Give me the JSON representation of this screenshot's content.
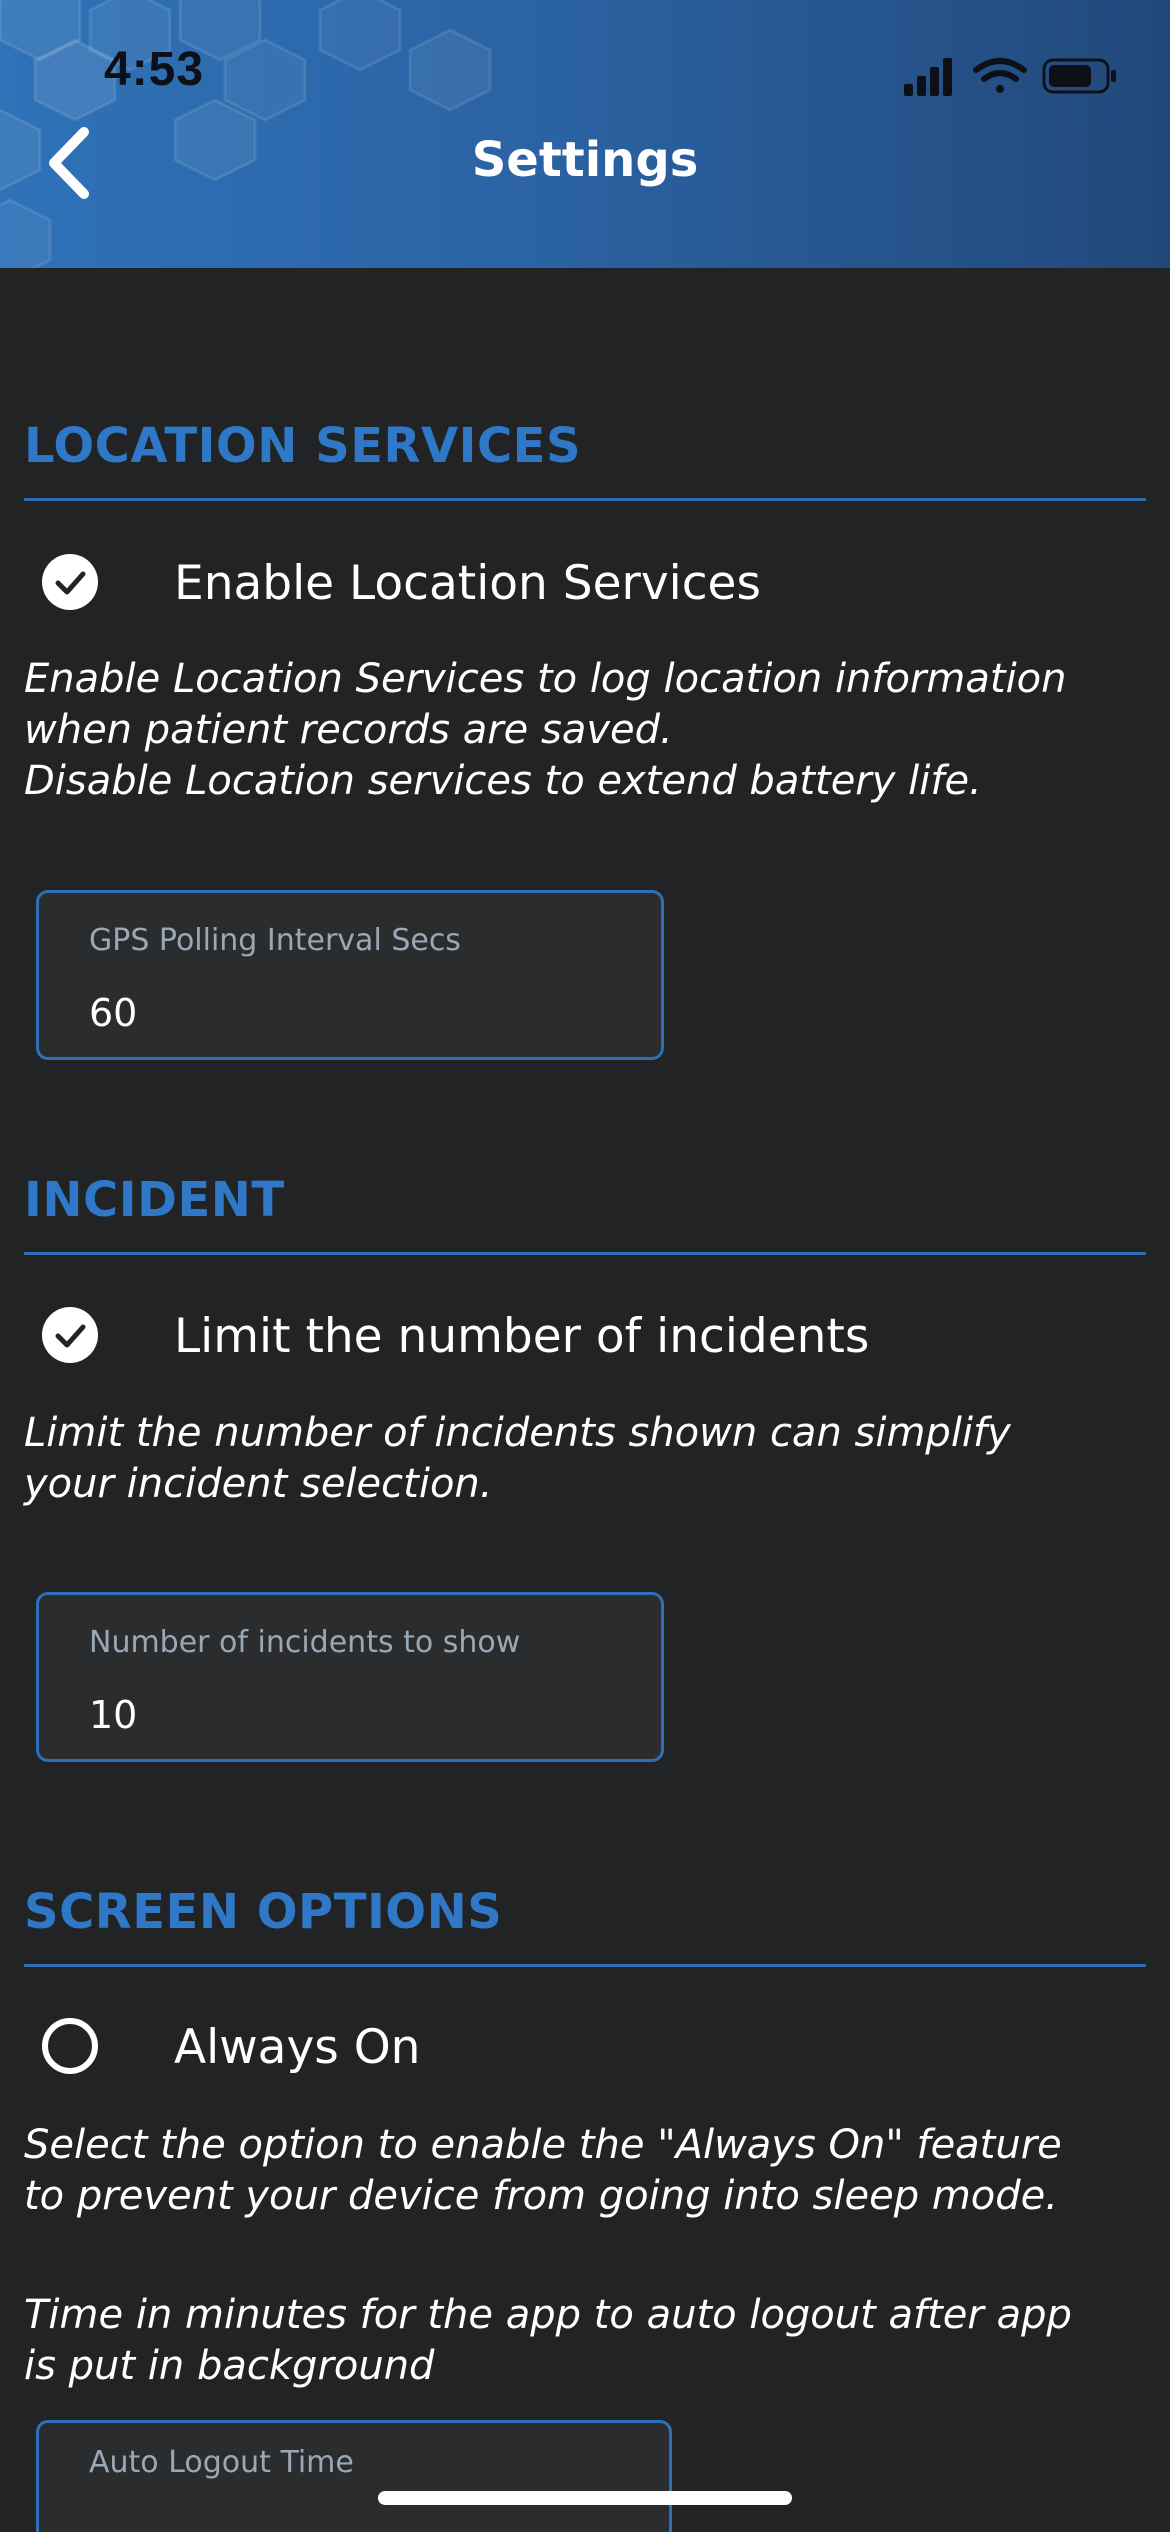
{
  "status_bar": {
    "time": "4:53"
  },
  "header": {
    "title": "Settings",
    "back_icon": "chevron-left-icon"
  },
  "sections": [
    {
      "title": "LOCATION SERVICES",
      "checkbox": {
        "label": "Enable Location Services",
        "checked": true
      },
      "description": "Enable Location Services to log location information\nwhen patient records are saved.\nDisable Location services to extend battery life.",
      "field": {
        "label": "GPS Polling Interval Secs",
        "value": "60"
      }
    },
    {
      "title": "INCIDENT",
      "checkbox": {
        "label": "Limit the number of incidents",
        "checked": true
      },
      "description": "Limit the number of incidents shown can simplify\nyour incident selection.",
      "field": {
        "label": "Number of incidents to show",
        "value": "10"
      }
    },
    {
      "title": "SCREEN OPTIONS",
      "checkbox": {
        "label": "Always On",
        "checked": false
      },
      "description": "Select the option to enable the \"Always On\" feature\nto prevent your device from going into sleep mode.",
      "description2": "Time in minutes for the app to auto logout after app\nis put in background",
      "field": {
        "label": "Auto Logout Time",
        "value": ""
      }
    }
  ],
  "colors": {
    "accent": "#2f78c8",
    "background": "#222324",
    "header_gradient_start": "#2f72b8",
    "header_gradient_end": "#22487a"
  }
}
